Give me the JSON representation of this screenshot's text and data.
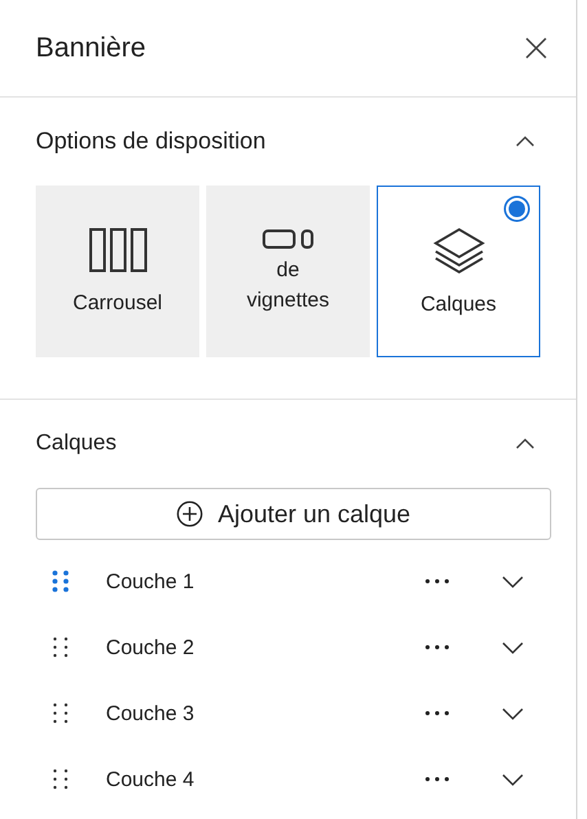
{
  "panel": {
    "title": "Bannière"
  },
  "layout_section": {
    "title": "Options de disposition",
    "expanded": true,
    "options": [
      {
        "kind": "carousel",
        "label": "Carrousel",
        "selected": false
      },
      {
        "kind": "tiles",
        "label": "de vignettes",
        "selected": false
      },
      {
        "kind": "layers",
        "label": "Calques",
        "selected": true
      }
    ]
  },
  "layers_section": {
    "title": "Calques",
    "expanded": true,
    "add_button": "Ajouter un calque",
    "layers": [
      {
        "name": "Couche 1",
        "selected": true
      },
      {
        "name": "Couche 2",
        "selected": false
      },
      {
        "name": "Couche 3",
        "selected": false
      },
      {
        "name": "Couche 4",
        "selected": false
      }
    ]
  }
}
